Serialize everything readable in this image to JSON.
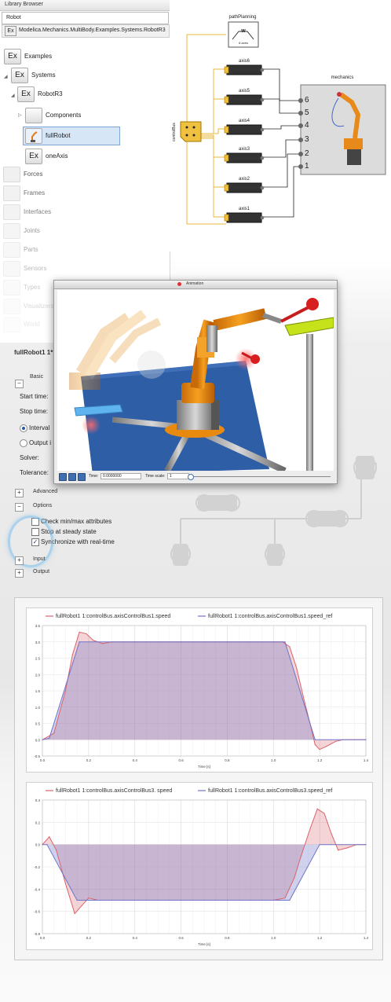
{
  "library": {
    "title": "Library Browser",
    "search_value": "Robot",
    "path_badge": "Ex",
    "path": "Modelica.Mechanics.MultiBody.Examples.Systems.RobotR3",
    "tree": [
      {
        "badge": "Ex",
        "label": "Examples"
      },
      {
        "badge": "Ex",
        "label": "Systems"
      },
      {
        "badge": "Ex",
        "label": "RobotR3"
      },
      {
        "badge": "",
        "label": "Components"
      },
      {
        "badge": "",
        "label": "fullRobot"
      },
      {
        "badge": "Ex",
        "label": "oneAxis"
      }
    ],
    "ghost_items": [
      "Forces",
      "Frames",
      "Interfaces",
      "Joints",
      "Parts",
      "Sensors",
      "Types",
      "Visualizers",
      "World"
    ]
  },
  "diagram": {
    "path_planning_label": "pathPlanning",
    "path_planning_symbol": "w",
    "path_planning_sub": "6 axes",
    "bus_label": "controlBus",
    "axes": [
      "axis6",
      "axis5",
      "axis4",
      "axis3",
      "axis2",
      "axis1"
    ],
    "mechanics_label": "mechanics",
    "port_numbers": [
      "6",
      "5",
      "4",
      "3",
      "2",
      "1"
    ],
    "wire_color": "#e7b93d"
  },
  "animation": {
    "title": "Animation",
    "time_label": "Time:",
    "time_value": "0.0000000",
    "scale_label": "Time scale:",
    "scale_value": "1"
  },
  "setup": {
    "tab_title": "fullRobot1 1*",
    "basic_label": "Basic",
    "start_time_label": "Start time:",
    "stop_time_label": "Stop time:",
    "interval_label": "Interval",
    "output_label": "Output i",
    "solver_label": "Solver:",
    "tolerance_label": "Tolerance:",
    "advanced_label": "Advanced",
    "options_label": "Options",
    "check_minmax": "Check min/max attributes",
    "stop_steady": "Stop at steady state",
    "sync_realtime": "Synchronize with real-time",
    "input_label": "Input",
    "output_section_label": "Output",
    "collapse_sign": "−",
    "expand_sign": "+",
    "checkmark": "✓"
  },
  "plots": {
    "colors": {
      "speed": "#d9646c",
      "ref": "#6d74c8",
      "fill": "#9a8bbf"
    },
    "top": {
      "legend_speed": "fullRobot1 1:controlBus.axisControlBus1.speed",
      "legend_ref": "fullRobot1 1:controlBus.axisControlBus1.speed_ref",
      "xlabel": "Time [s]",
      "xticks": [
        "0.0",
        "0.2",
        "0.4",
        "0.6",
        "0.8",
        "1.0",
        "1.2",
        "1.4"
      ],
      "yticks": [
        "3.5",
        "3.0",
        "2.5",
        "2.0",
        "1.5",
        "1.0",
        "0.5",
        "0.0",
        "-0.5"
      ]
    },
    "bottom": {
      "legend_speed": "fullRobot1 1:controlBus.axisControlBus3. speed",
      "legend_ref": "fullRobot1 1:controlBus.axisControlBus3.speed_ref",
      "xlabel": "Time [s]",
      "xticks": [
        "0.0",
        "0.2",
        "0.4",
        "0.6",
        "0.8",
        "1.0",
        "1.2",
        "1.4"
      ],
      "yticks": [
        "0.4",
        "0.2",
        "0.0",
        "-0.2",
        "-0.4",
        "-0.6",
        "-0.8"
      ]
    }
  },
  "chart_data": [
    {
      "type": "line",
      "title": "",
      "xlabel": "Time [s]",
      "ylabel": "",
      "xlim": [
        0,
        1.4
      ],
      "ylim": [
        -0.5,
        3.5
      ],
      "grid": true,
      "legend": "top",
      "series": [
        {
          "name": "fullRobot1 1:controlBus.axisControlBus1.speed",
          "x": [
            0.0,
            0.05,
            0.1,
            0.13,
            0.16,
            0.19,
            0.22,
            0.26,
            0.3,
            0.4,
            0.6,
            0.8,
            1.0,
            1.04,
            1.07,
            1.1,
            1.13,
            1.16,
            1.18,
            1.2,
            1.23,
            1.27,
            1.3,
            1.35,
            1.4
          ],
          "y": [
            0.0,
            0.2,
            1.5,
            2.6,
            3.3,
            3.25,
            3.05,
            2.95,
            3.0,
            3.0,
            3.0,
            3.0,
            3.0,
            3.0,
            2.85,
            2.2,
            1.3,
            0.45,
            -0.15,
            -0.3,
            -0.2,
            -0.05,
            0.0,
            0.0,
            0.0
          ]
        },
        {
          "name": "fullRobot1 1:controlBus.axisControlBus1.speed_ref",
          "x": [
            0.0,
            0.03,
            0.16,
            1.05,
            1.18,
            1.4
          ],
          "y": [
            0.0,
            0.05,
            3.0,
            3.0,
            0.0,
            0.0
          ]
        }
      ]
    },
    {
      "type": "line",
      "title": "",
      "xlabel": "Time [s]",
      "ylabel": "",
      "xlim": [
        0,
        1.4
      ],
      "ylim": [
        -0.8,
        0.4
      ],
      "grid": true,
      "legend": "top",
      "series": [
        {
          "name": "fullRobot1 1:controlBus.axisControlBus3. speed",
          "x": [
            0.0,
            0.03,
            0.06,
            0.1,
            0.14,
            0.17,
            0.2,
            0.24,
            0.3,
            0.4,
            0.6,
            0.8,
            1.0,
            1.05,
            1.09,
            1.12,
            1.16,
            1.19,
            1.22,
            1.25,
            1.28,
            1.32,
            1.36,
            1.4
          ],
          "y": [
            0.0,
            0.07,
            -0.05,
            -0.35,
            -0.62,
            -0.55,
            -0.48,
            -0.5,
            -0.5,
            -0.5,
            -0.5,
            -0.5,
            -0.5,
            -0.48,
            -0.3,
            -0.1,
            0.15,
            0.32,
            0.28,
            0.1,
            -0.05,
            -0.03,
            0.0,
            0.0
          ]
        },
        {
          "name": "fullRobot1 1:controlBus.axisControlBus3.speed_ref",
          "x": [
            0.0,
            0.02,
            0.15,
            1.07,
            1.2,
            1.4
          ],
          "y": [
            0.0,
            0.0,
            -0.5,
            -0.5,
            0.0,
            0.0
          ]
        }
      ]
    }
  ]
}
